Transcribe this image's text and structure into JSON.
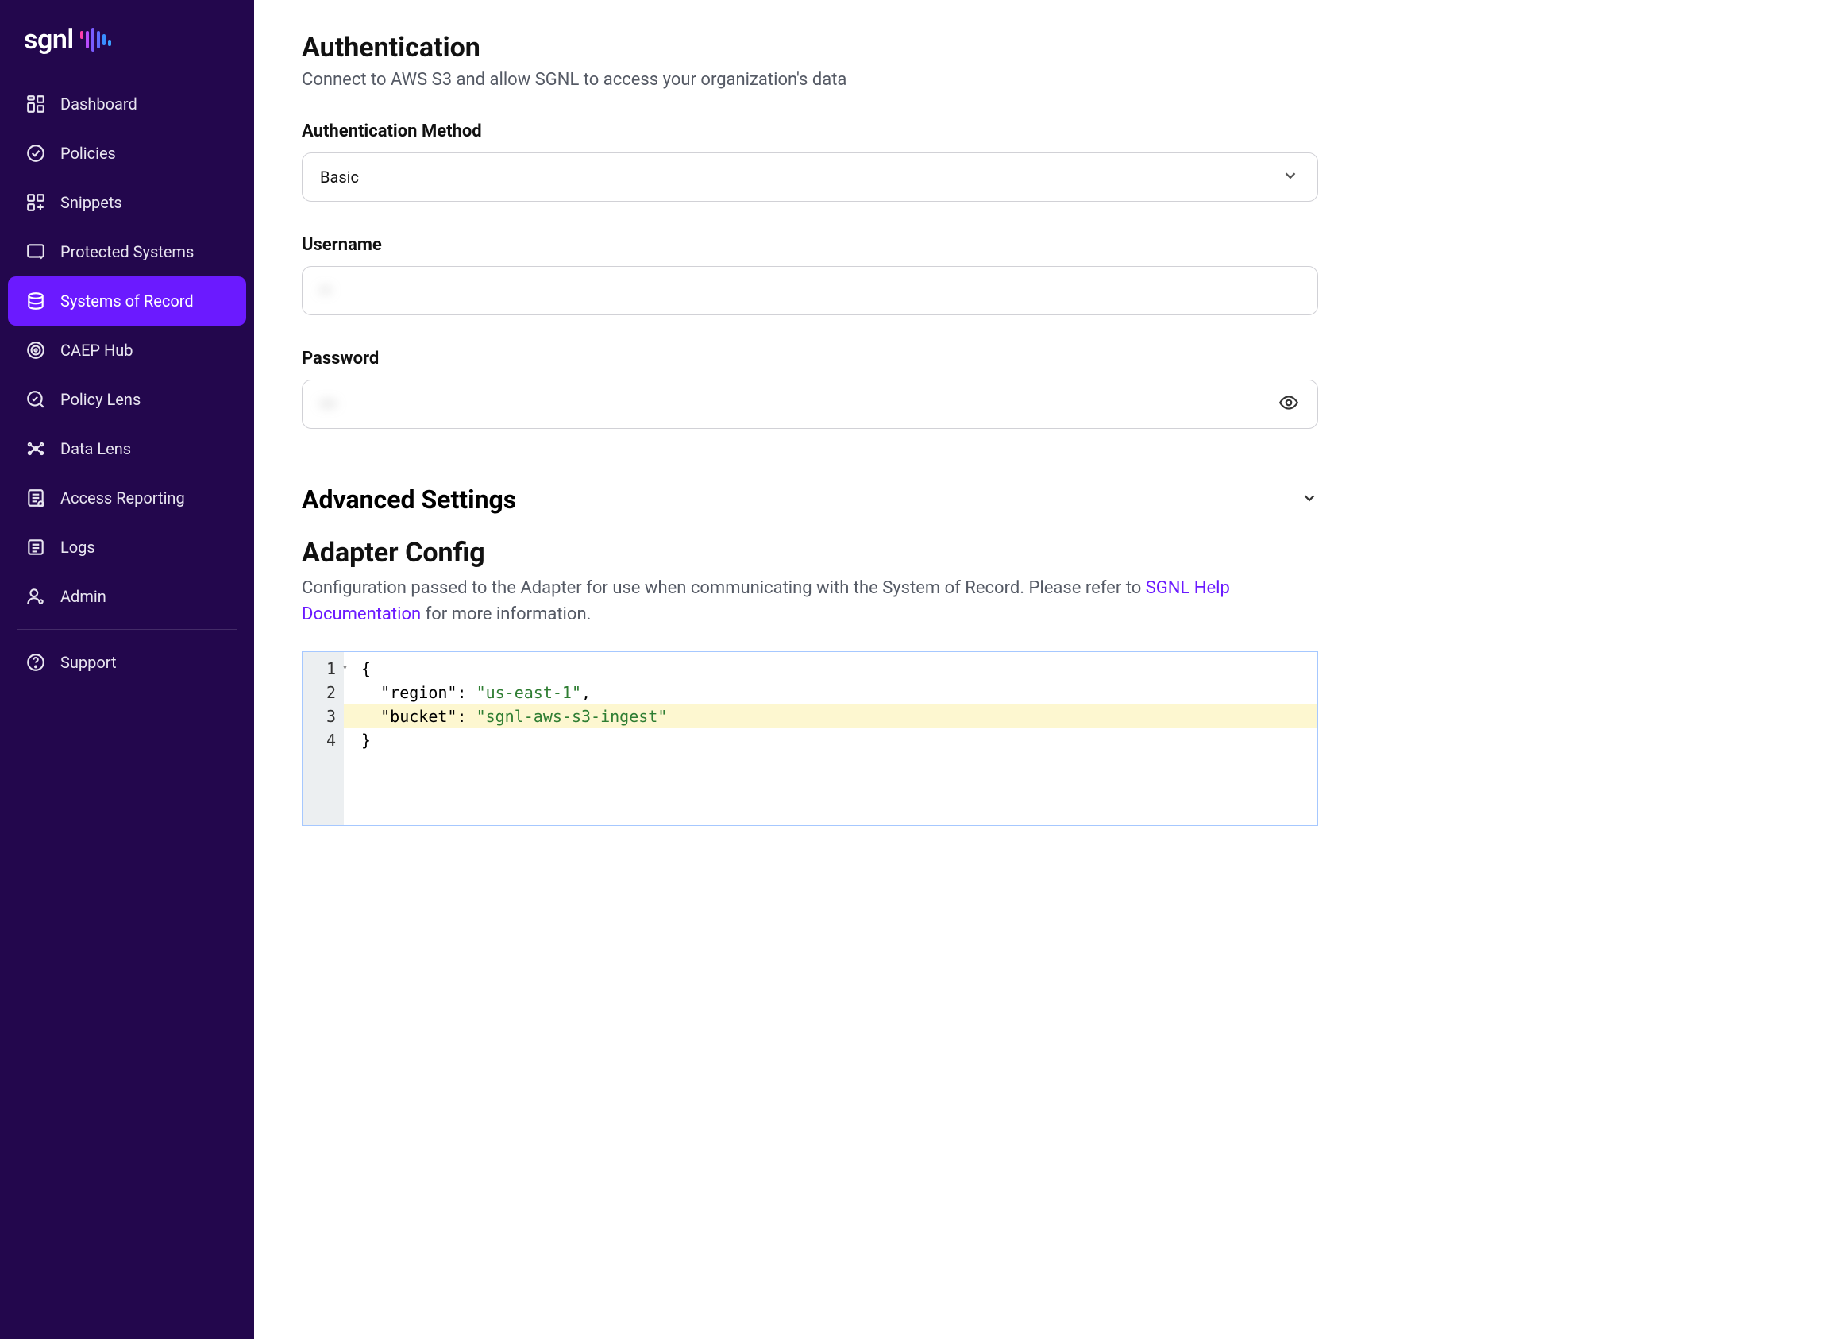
{
  "brand": {
    "name": "sgnl"
  },
  "sidebar": {
    "items": [
      {
        "label": "Dashboard"
      },
      {
        "label": "Policies"
      },
      {
        "label": "Snippets"
      },
      {
        "label": "Protected Systems"
      },
      {
        "label": "Systems of Record"
      },
      {
        "label": "CAEP Hub"
      },
      {
        "label": "Policy Lens"
      },
      {
        "label": "Data Lens"
      },
      {
        "label": "Access Reporting"
      },
      {
        "label": "Logs"
      },
      {
        "label": "Admin"
      },
      {
        "label": "Support"
      }
    ]
  },
  "auth": {
    "title": "Authentication",
    "subtitle": "Connect to AWS S3 and allow SGNL to access your organization's data",
    "method_label": "Authentication Method",
    "method_value": "Basic",
    "username_label": "Username",
    "username_masked": "••",
    "password_label": "Password",
    "password_masked": "•••"
  },
  "advanced": {
    "title": "Advanced Settings"
  },
  "adapter": {
    "title": "Adapter Config",
    "desc_prefix": "Configuration passed to the Adapter for use when communicating with the System of Record. Please refer to ",
    "link_text": "SGNL Help Documentation",
    "desc_suffix": " for more information.",
    "code": {
      "line1": "{",
      "line2_key": "\"region\"",
      "line2_val": "\"us-east-1\"",
      "line3_key": "\"bucket\"",
      "line3_val": "\"sgnl-aws-s3-ingest\"",
      "line4": "}",
      "num1": "1",
      "num2": "2",
      "num3": "3",
      "num4": "4"
    }
  },
  "colors": {
    "sidebar_bg": "#23074d",
    "accent": "#6b1aff"
  }
}
